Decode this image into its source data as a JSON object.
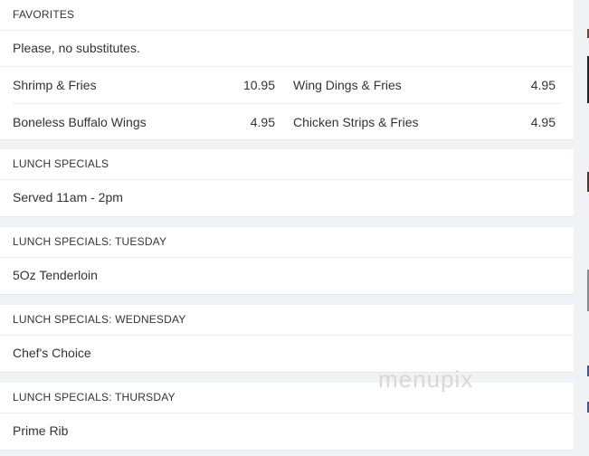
{
  "favorites": {
    "title": "FAVORITES",
    "note": "Please, no substitutes.",
    "rows": [
      [
        {
          "name": "Shrimp & Fries",
          "price": "10.95"
        },
        {
          "name": "Wing Dings & Fries",
          "price": "4.95"
        }
      ],
      [
        {
          "name": "Boneless Buffalo Wings",
          "price": "4.95"
        },
        {
          "name": "Chicken Strips & Fries",
          "price": "4.95"
        }
      ]
    ]
  },
  "lunch_specials": {
    "title": "LUNCH SPECIALS",
    "item": "Served 11am - 2pm"
  },
  "tuesday": {
    "title": "LUNCH SPECIALS: TUESDAY",
    "item": "5Oz Tenderloin"
  },
  "wednesday": {
    "title": "LUNCH SPECIALS: WEDNESDAY",
    "item": "Chef's Choice"
  },
  "thursday": {
    "title": "LUNCH SPECIALS: THURSDAY",
    "item": "Prime Rib"
  },
  "watermark": "menupix"
}
